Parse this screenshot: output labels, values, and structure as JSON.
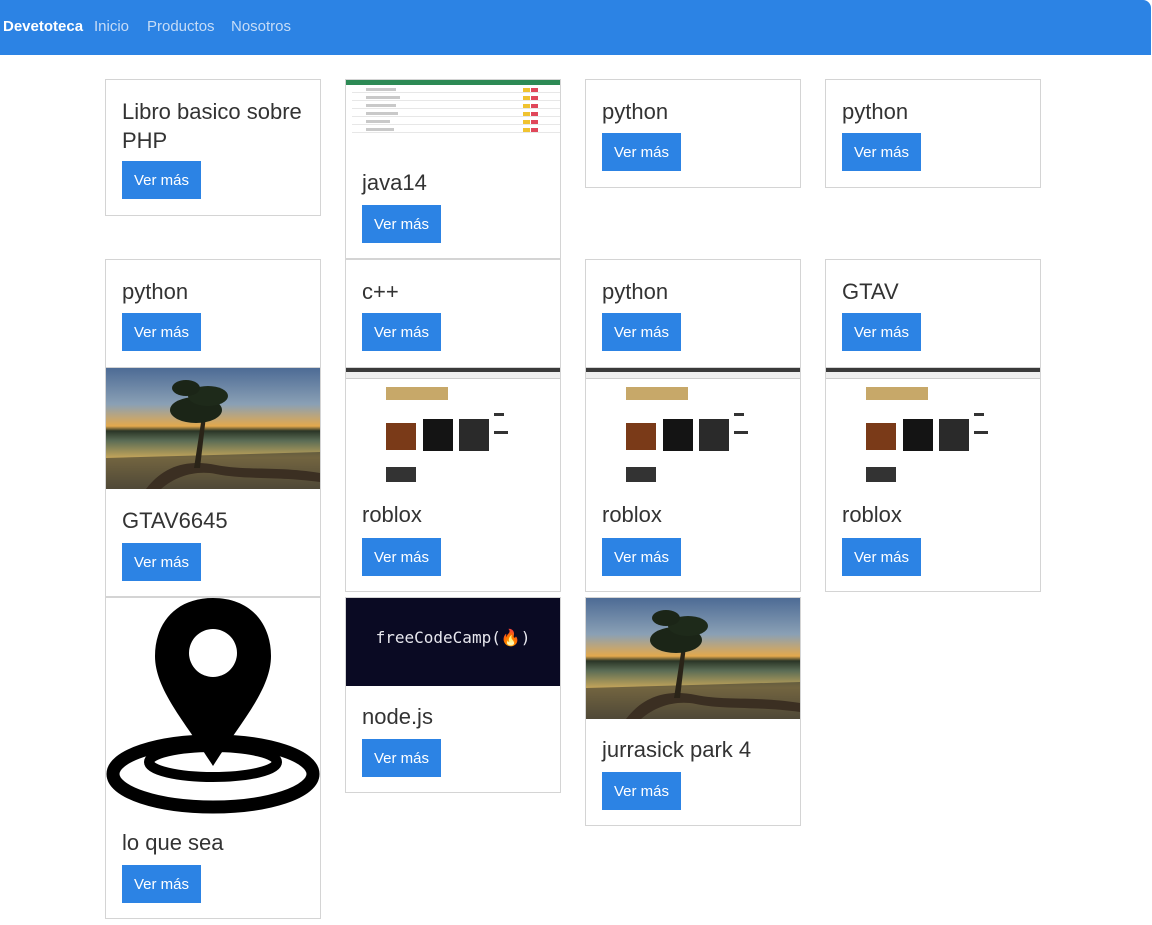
{
  "navbar": {
    "brand": "Devetoteca",
    "links": [
      "Inicio",
      "Productos",
      "Nosotros"
    ],
    "accent_color": "#2c83e4"
  },
  "cards": [
    {
      "title": "Libro basico sobre PHP",
      "button": "Ver más",
      "image": "none"
    },
    {
      "title": "java14",
      "button": "Ver más",
      "image": "table-screenshot"
    },
    {
      "title": "python",
      "button": "Ver más",
      "image": "none"
    },
    {
      "title": "python",
      "button": "Ver más",
      "image": "none"
    },
    {
      "title": "python",
      "button": "Ver más",
      "image": "none"
    },
    {
      "title": "c++",
      "button": "Ver más",
      "image": "none"
    },
    {
      "title": "python",
      "button": "Ver más",
      "image": "none"
    },
    {
      "title": "GTAV",
      "button": "Ver más",
      "image": "none"
    },
    {
      "title": "GTAV6645",
      "button": "Ver más",
      "image": "lake-tree-photo"
    },
    {
      "title": "roblox",
      "button": "Ver más",
      "image": "store-screenshot"
    },
    {
      "title": "roblox",
      "button": "Ver más",
      "image": "store-screenshot"
    },
    {
      "title": "roblox",
      "button": "Ver más",
      "image": "store-screenshot"
    },
    {
      "title": "lo que sea",
      "button": "Ver más",
      "image": "location-pin-icon"
    },
    {
      "title": "node.js",
      "button": "Ver más",
      "image": "freecodecamp-logo",
      "image_text": "freeCodeCamp(🔥)"
    },
    {
      "title": "jurrasick park 4",
      "button": "Ver más",
      "image": "lake-tree-photo"
    }
  ]
}
